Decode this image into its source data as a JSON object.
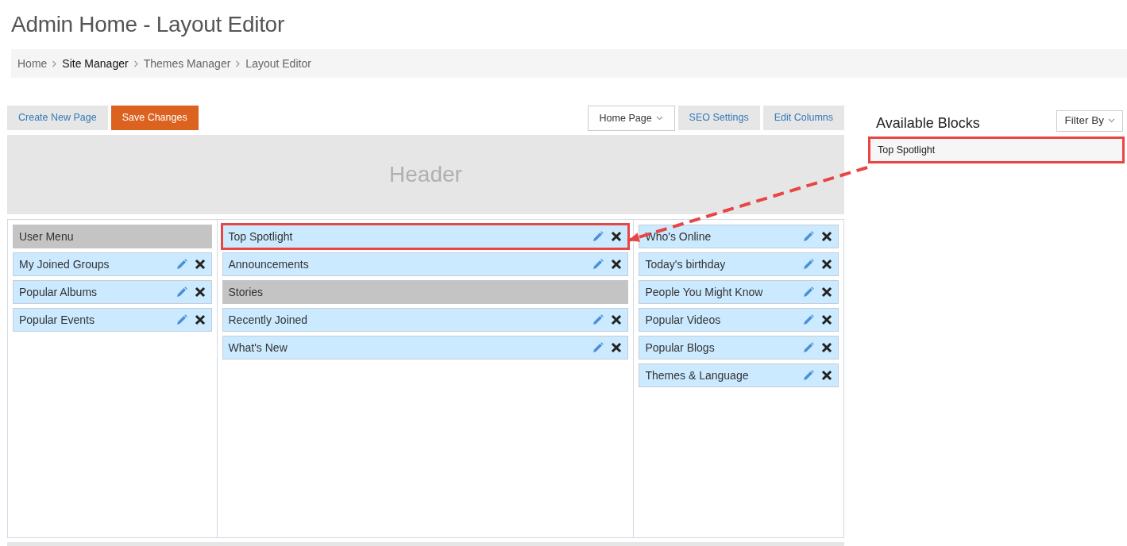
{
  "page_title": "Admin Home - Layout Editor",
  "breadcrumb": [
    {
      "label": "Home",
      "hovered": false
    },
    {
      "label": "Site Manager",
      "hovered": true
    },
    {
      "label": "Themes Manager",
      "hovered": false
    },
    {
      "label": "Layout Editor",
      "hovered": false
    }
  ],
  "toolbar": {
    "left_buttons": [
      {
        "label": "Create New Page",
        "kind": "light"
      },
      {
        "label": "Save Changes",
        "kind": "primary"
      }
    ],
    "page_select": {
      "value": "Home Page"
    },
    "right_buttons": [
      {
        "label": "SEO Settings",
        "kind": "light"
      },
      {
        "label": "Edit Columns",
        "kind": "light"
      }
    ]
  },
  "header_area": {
    "label": "Header"
  },
  "columns": [
    {
      "blocks": [
        {
          "label": "User Menu",
          "kind": "section",
          "highlighted": false
        },
        {
          "label": "My Joined Groups",
          "kind": "block",
          "highlighted": false
        },
        {
          "label": "Popular Albums",
          "kind": "block",
          "highlighted": false
        },
        {
          "label": "Popular Events",
          "kind": "block",
          "highlighted": false
        }
      ]
    },
    {
      "blocks": [
        {
          "label": "Top Spotlight",
          "kind": "block",
          "highlighted": true
        },
        {
          "label": "Announcements",
          "kind": "block",
          "highlighted": false
        },
        {
          "label": "Stories",
          "kind": "section",
          "highlighted": false
        },
        {
          "label": "Recently Joined",
          "kind": "block",
          "highlighted": false
        },
        {
          "label": "What's New",
          "kind": "block",
          "highlighted": false
        }
      ]
    },
    {
      "blocks": [
        {
          "label": "Who's Online",
          "kind": "block",
          "highlighted": false
        },
        {
          "label": "Today's birthday",
          "kind": "block",
          "highlighted": false
        },
        {
          "label": "People You Might Know",
          "kind": "block",
          "highlighted": false
        },
        {
          "label": "Popular Videos",
          "kind": "block",
          "highlighted": false
        },
        {
          "label": "Popular Blogs",
          "kind": "block",
          "highlighted": false
        },
        {
          "label": "Themes & Language",
          "kind": "block",
          "highlighted": false
        }
      ]
    }
  ],
  "available_blocks": {
    "title": "Available Blocks",
    "filter": "Filter By",
    "items": [
      {
        "label": "Top Spotlight",
        "highlighted": true
      }
    ]
  }
}
